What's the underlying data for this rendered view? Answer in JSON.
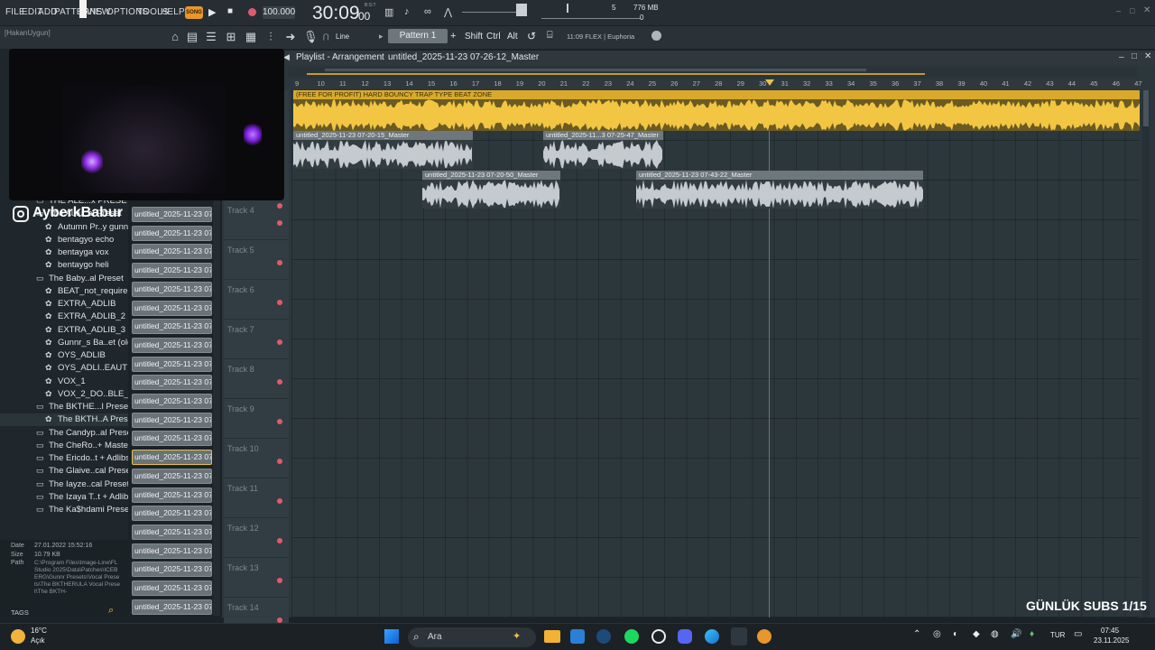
{
  "menu": {
    "items": [
      "FILE",
      "EDIT",
      "ADD",
      "PATTERNS",
      "VIEW",
      "OPTIONS",
      "TOOLS",
      "HELP"
    ]
  },
  "transport": {
    "mode_label": "SONG",
    "tempo": "100.000",
    "time": "30:09",
    "time_frac": "00",
    "time_label": "B:S:T",
    "cpu_value": "5",
    "memory": "776 MB",
    "memory_sub": "0"
  },
  "toolbar2": {
    "user": "[HakanUygun]",
    "snap": "Line",
    "pattern": "Pattern 1",
    "shift": "Shift",
    "ctrl": "Ctrl",
    "alt": "Alt",
    "flex_hint": "11:09  FLEX | Euphoria"
  },
  "webcam": {
    "handle": "AyberkBabur"
  },
  "browser": {
    "rows": [
      {
        "label": "THE ALE...x PRESET",
        "type": "folder",
        "indent": 0
      },
      {
        "label": "The Autu..al Preset",
        "type": "folder",
        "indent": 0
      },
      {
        "label": "Autumn Pr..y gunnr)",
        "type": "preset",
        "indent": 1
      },
      {
        "label": "bentagyo echo",
        "type": "preset",
        "indent": 1
      },
      {
        "label": "bentayga vox",
        "type": "preset",
        "indent": 1
      },
      {
        "label": "bentaygo heli",
        "type": "preset",
        "indent": 1
      },
      {
        "label": "The Baby..al Preset",
        "type": "folder",
        "indent": 0
      },
      {
        "label": "BEAT_not_required",
        "type": "preset",
        "indent": 1
      },
      {
        "label": "EXTRA_ADLIB",
        "type": "preset",
        "indent": 1
      },
      {
        "label": "EXTRA_ADLIB_2",
        "type": "preset",
        "indent": 1
      },
      {
        "label": "EXTRA_ADLIB_3",
        "type": "preset",
        "indent": 1
      },
      {
        "label": "Gunnr_s Ba..et (old)",
        "type": "preset",
        "indent": 1
      },
      {
        "label": "OYS_ADLIB",
        "type": "preset",
        "indent": 1
      },
      {
        "label": "OYS_ADLI..EAUTIFUL",
        "type": "preset",
        "indent": 1
      },
      {
        "label": "VOX_1",
        "type": "preset",
        "indent": 1
      },
      {
        "label": "VOX_2_DO..BLE_EAR",
        "type": "preset",
        "indent": 1
      },
      {
        "label": "The BKTHE...l Preset",
        "type": "folder",
        "indent": 0
      },
      {
        "label": "The BKTH..A Preset",
        "type": "preset",
        "indent": 1
      },
      {
        "label": "The Candyp..al Preset",
        "type": "folder",
        "indent": 0
      },
      {
        "label": "The CheRo..+ Master",
        "type": "folder",
        "indent": 0
      },
      {
        "label": "The Ericdo..t + Adlibs",
        "type": "folder",
        "indent": 0
      },
      {
        "label": "The Glaive..cal Preset",
        "type": "folder",
        "indent": 0
      },
      {
        "label": "The Iayze..cal Preset",
        "type": "folder",
        "indent": 0
      },
      {
        "label": "The Izaya T..t + Adlibs",
        "type": "folder",
        "indent": 0
      },
      {
        "label": "The Ka$hdami Preset",
        "type": "folder",
        "indent": 0
      }
    ],
    "info": {
      "date_label": "Date",
      "date": "27.01.2022 15:52:16",
      "size_label": "Size",
      "size": "10.79 KB",
      "path_label": "Path",
      "path": "C:\\Program Files\\Image-Line\\FL Studio 2025\\Data\\Patches\\ICEBERG\\Gunnr Presets\\Vocal Presets\\The BKTHERULA Vocal Preset\\The BKTH-"
    },
    "tags_label": "TAGS"
  },
  "channels": {
    "items": [
      "untitled_2025-11-23 07-...",
      "untitled_2025-11-23 07-...",
      "untitled_2025-11-23 07-...",
      "untitled_2025-11-23 07-...",
      "untitled_2025-11-23 07-...",
      "untitled_2025-11-23 07-...",
      "untitled_2025-11-23 07-...",
      "untitled_2025-11-23 07-...",
      "untitled_2025-11-23 07-...",
      "untitled_2025-11-23 07-...",
      "untitled_2025-11-23 07-...",
      "untitled_2025-11-23 07-...",
      "untitled_2025-11-23 07-...",
      "untitled_2025-11-23 07-...",
      "untitled_2025-11-23 07-...",
      "untitled_2025-11-23 07-...",
      "untitled_2025-11-23 07-...",
      "untitled_2025-11-23 07-...",
      "untitled_2025-11-23 07-...",
      "untitled_2025-11-23 07-...",
      "untitled_2025-11-23 07-...",
      "untitled_2025-11-23 07-..."
    ]
  },
  "playlist": {
    "title": "Playlist - Arrangement",
    "song": "untitled_2025-11-23 07-26-12_Master",
    "ruler": [
      "9",
      "10",
      "11",
      "12",
      "13",
      "14",
      "15",
      "16",
      "17",
      "18",
      "19",
      "20",
      "21",
      "22",
      "23",
      "24",
      "25",
      "26",
      "27",
      "28",
      "29",
      "30",
      "31",
      "32",
      "33",
      "34",
      "35",
      "36",
      "37",
      "38",
      "39",
      "40",
      "41",
      "42",
      "43",
      "44",
      "45",
      "46",
      "47"
    ],
    "tracks": [
      "Track 4",
      "Track 5",
      "Track 6",
      "Track 7",
      "Track 8",
      "Track 9",
      "Track 10",
      "Track 11",
      "Track 12",
      "Track 13",
      "Track 14"
    ],
    "clips": [
      {
        "label": "(FREE FOR PROFIT) HARD BOUNCY TRAP TYPE BEAT ZONE",
        "color": "#e8c04a"
      },
      {
        "label": "untitled_2025-11-23 07-20-15_Master",
        "color": "#9aa1a5"
      },
      {
        "label": "untitled_2025-11...3 07-25-47_Master",
        "color": "#9aa1a5"
      },
      {
        "label": "untitled_2025-11-23 07-20-50_Master",
        "color": "#9aa1a5"
      },
      {
        "label": "untitled_2025-11-23 07-43-22_Master",
        "color": "#9aa1a5"
      }
    ]
  },
  "overlay": {
    "subs": "GÜNLÜK SUBS 1/15"
  },
  "taskbar": {
    "weather_temp": "16°C",
    "weather_desc": "Açık",
    "search": "Ara",
    "lang": "TUR",
    "clock_time": "07:45",
    "clock_date": "23.11.2025"
  },
  "colors": {
    "accent_yellow": "#e8c04a",
    "record_red": "#e05a6b",
    "clip_gray": "#9aa1a5"
  }
}
